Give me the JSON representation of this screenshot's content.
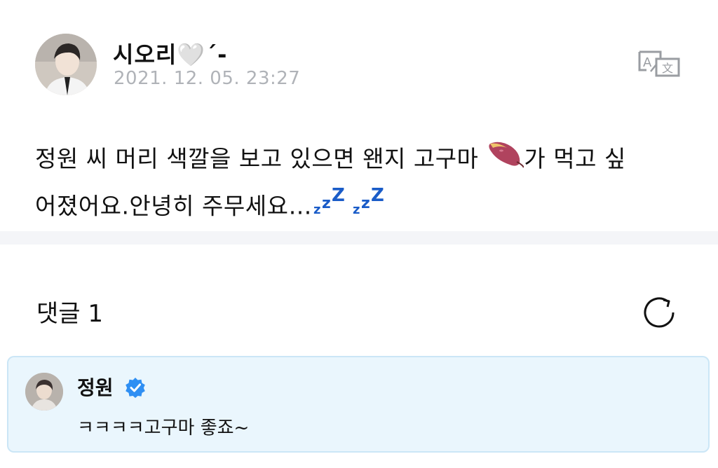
{
  "post": {
    "author_name": "시오리🤍´-",
    "date": "2021. 12. 05. 23:27",
    "body_line1_before": "정원 씨 머리 색깔을 보고 있으면 왠지 고구마 ",
    "body_line1_after": "가 먹고 싶",
    "body_line2": "어졌어요.안녕히 주무세요…"
  },
  "icons": {
    "translate": "translate-icon",
    "sweet_potato": "sweet-potato-emoji",
    "sleep": "zzz-emoji",
    "refresh": "refresh-icon",
    "verified": "verified-badge-icon"
  },
  "comments": {
    "header_label": "댓글 1"
  },
  "comment": {
    "author_name": "정원",
    "text": "ㅋㅋㅋㅋ고구마 좋죠~"
  },
  "colors": {
    "date_gray": "#b0b3b8",
    "divider": "#f4f5f8",
    "comment_bg": "#eaf6fd",
    "comment_border": "#cbe6f6",
    "verified_blue": "#2f8ff3",
    "zzz_blue": "#1a5cc8",
    "potato_purple": "#b0435e"
  }
}
